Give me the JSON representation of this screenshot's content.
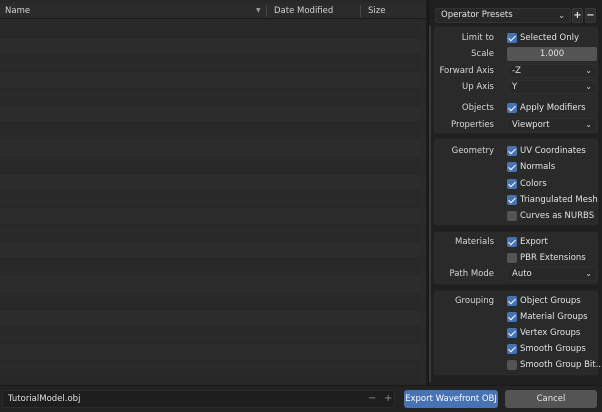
{
  "browser": {
    "columns": {
      "name": "Name",
      "date": "Date Modified",
      "size": "Size"
    },
    "row_count": 21
  },
  "sidebar": {
    "presets": {
      "label": "Operator Presets",
      "add": "+",
      "remove": "−"
    },
    "limit_to": {
      "label": "Limit to",
      "selected_only": {
        "label": "Selected Only",
        "checked": true
      }
    },
    "scale": {
      "label": "Scale",
      "value": "1.000"
    },
    "forward_axis": {
      "label": "Forward Axis",
      "value": "-Z"
    },
    "up_axis": {
      "label": "Up Axis",
      "value": "Y"
    },
    "objects": {
      "label": "Objects",
      "apply_modifiers": {
        "label": "Apply Modifiers",
        "checked": true
      }
    },
    "properties": {
      "label": "Properties",
      "value": "Viewport"
    },
    "geometry": {
      "label": "Geometry",
      "items": [
        {
          "label": "UV Coordinates",
          "checked": true
        },
        {
          "label": "Normals",
          "checked": true
        },
        {
          "label": "Colors",
          "checked": true
        },
        {
          "label": "Triangulated Mesh",
          "checked": true
        },
        {
          "label": "Curves as NURBS",
          "checked": false
        }
      ]
    },
    "materials": {
      "label": "Materials",
      "export": {
        "label": "Export",
        "checked": true
      },
      "pbr": {
        "label": "PBR Extensions",
        "checked": false
      },
      "path_mode": {
        "label": "Path Mode",
        "value": "Auto"
      }
    },
    "grouping": {
      "label": "Grouping",
      "items": [
        {
          "label": "Object Groups",
          "checked": true
        },
        {
          "label": "Material Groups",
          "checked": true
        },
        {
          "label": "Vertex Groups",
          "checked": true
        },
        {
          "label": "Smooth Groups",
          "checked": true
        },
        {
          "label": "Smooth Group Bit...",
          "checked": false
        }
      ]
    }
  },
  "bottom": {
    "filename": "TutorialModel.obj",
    "decrement": "−",
    "increment": "+",
    "export_label": "Export Wavefront OBJ",
    "cancel_label": "Cancel"
  },
  "colors": {
    "accent": "#4772b3",
    "panel": "#2a2a2a",
    "background": "#1d1d1d"
  }
}
